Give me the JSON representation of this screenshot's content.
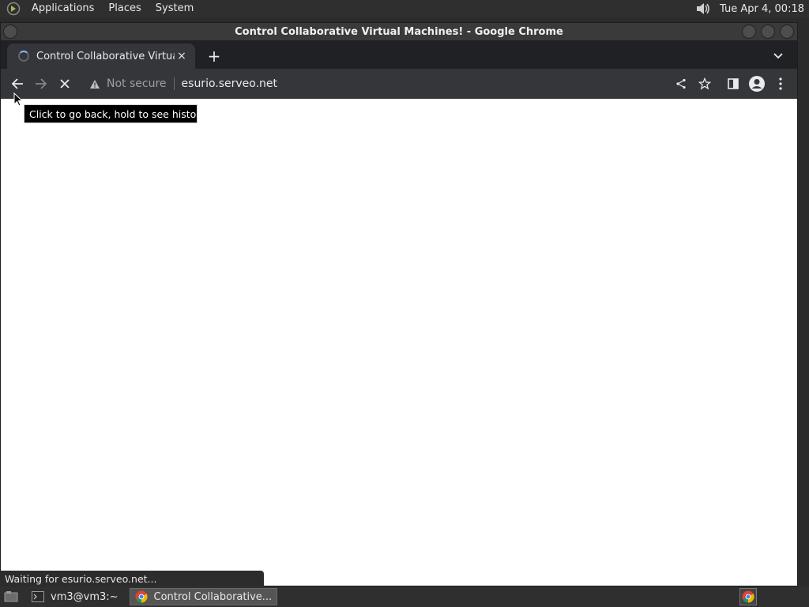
{
  "top_panel": {
    "menus": [
      "Applications",
      "Places",
      "System"
    ],
    "clock": "Tue Apr  4, 00:18",
    "icons": {
      "logo": "distro-logo-icon",
      "volume": "volume-icon"
    }
  },
  "window": {
    "title": "Control Collaborative Virtual Machines! - Google Chrome"
  },
  "tab": {
    "title": "Control Collaborative Virtual M",
    "close_label": "×",
    "new_tab_label": "+"
  },
  "toolbar": {
    "security_label": "Not secure",
    "url": "esurio.serveo.net"
  },
  "tooltip": {
    "text": "Click to go back, hold to see history"
  },
  "status": {
    "text": "Waiting for esurio.serveo.net..."
  },
  "taskbar": {
    "tasks": [
      {
        "label": "vm3@vm3:~",
        "icon": "terminal-icon"
      },
      {
        "label": "Control Collaborative...",
        "icon": "chrome-icon"
      }
    ]
  },
  "colors": {
    "panel_bg": "#2f2f2f",
    "chrome_frame": "#202124",
    "chrome_toolbar": "#35363a",
    "content_bg": "#ffffff"
  }
}
